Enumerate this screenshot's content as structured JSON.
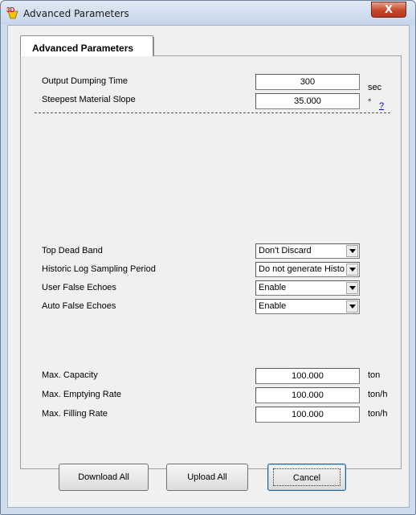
{
  "window": {
    "title": "Advanced Parameters",
    "close_label": "X"
  },
  "tab": {
    "label": "Advanced Parameters"
  },
  "output_dumping_time": {
    "label": "Output Dumping Time",
    "value": "300",
    "unit": "sec"
  },
  "steepest_material_slope": {
    "label": "Steepest Material Slope",
    "value": "35.000",
    "unit": "°",
    "help": "?"
  },
  "top_dead_band": {
    "label": "Top Dead Band",
    "value": "Don't Discard"
  },
  "historic_log": {
    "label": "Historic Log Sampling Period",
    "value": "Do not generate Histoı"
  },
  "user_false_echoes": {
    "label": "User False Echoes",
    "value": "Enable"
  },
  "auto_false_echoes": {
    "label": "Auto False Echoes",
    "value": "Enable"
  },
  "max_capacity": {
    "label": "Max. Capacity",
    "value": "100.000",
    "unit": "ton"
  },
  "max_emptying_rate": {
    "label": "Max. Emptying Rate",
    "value": "100.000",
    "unit": "ton/h"
  },
  "max_filling_rate": {
    "label": "Max. Filling Rate",
    "value": "100.000",
    "unit": "ton/h"
  },
  "buttons": {
    "download_all": "Download All",
    "upload_all": "Upload All",
    "cancel": "Cancel"
  },
  "icons": {
    "app": "3d-app-icon",
    "dropdown": "chevron-down-icon",
    "close": "close-icon"
  }
}
